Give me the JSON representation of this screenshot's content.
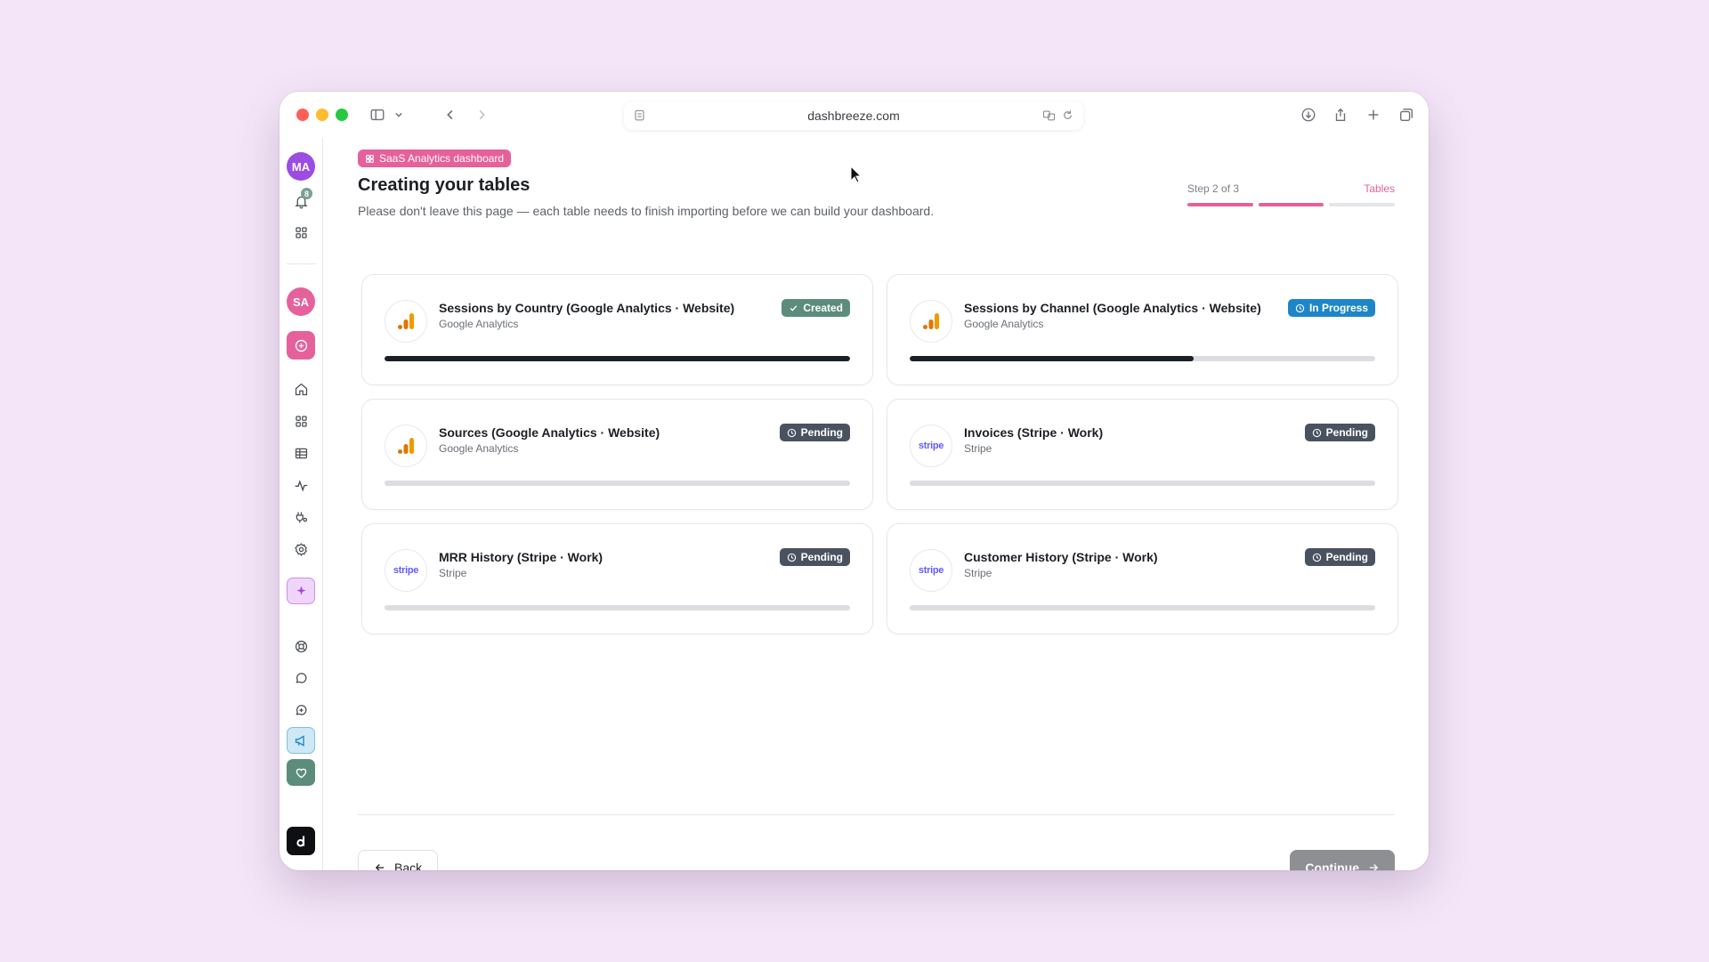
{
  "browser": {
    "url": "dashbreeze.com"
  },
  "sidebar": {
    "user_initials": "MA",
    "notification_count": "8",
    "workspace_initials": "SA",
    "colors": {
      "user": "#9b4de3",
      "workspace": "#e6619b",
      "accent": "#e6619b"
    }
  },
  "header": {
    "tag_label": "SaaS Analytics dashboard",
    "title": "Creating your tables",
    "subtitle": "Please don't leave this page — each table needs to finish importing before we can build your dashboard.",
    "step_label": "Step 2 of 3",
    "step_name": "Tables",
    "steps_completed": 2,
    "steps_total": 3
  },
  "tables": [
    {
      "title": "Sessions by Country (Google Analytics · Website)",
      "source": "Google Analytics",
      "logo": "google-analytics-icon",
      "status": "Created",
      "progress": 1.0
    },
    {
      "title": "Sessions by Channel (Google Analytics · Website)",
      "source": "Google Analytics",
      "logo": "google-analytics-icon",
      "status": "In Progress",
      "progress": 0.61
    },
    {
      "title": "Sources (Google Analytics · Website)",
      "source": "Google Analytics",
      "logo": "google-analytics-icon",
      "status": "Pending",
      "progress": 0
    },
    {
      "title": "Invoices (Stripe · Work)",
      "source": "Stripe",
      "logo": "stripe-icon",
      "logo_text": "stripe",
      "status": "Pending",
      "progress": 0
    },
    {
      "title": "MRR History (Stripe · Work)",
      "source": "Stripe",
      "logo": "stripe-icon",
      "logo_text": "stripe",
      "status": "Pending",
      "progress": 0
    },
    {
      "title": "Customer History (Stripe · Work)",
      "source": "Stripe",
      "logo": "stripe-icon",
      "logo_text": "stripe",
      "status": "Pending",
      "progress": 0
    }
  ],
  "footer": {
    "back_label": "Back",
    "continue_label": "Continue"
  }
}
